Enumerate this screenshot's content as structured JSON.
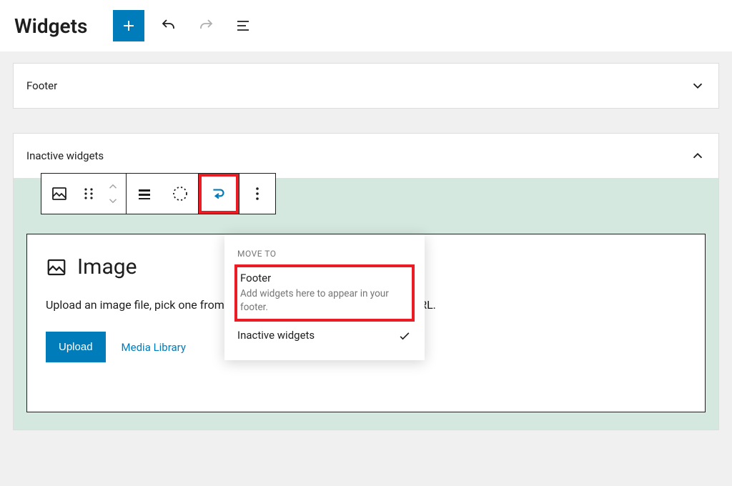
{
  "topbar": {
    "title": "Widgets"
  },
  "areas": {
    "footer": {
      "label": "Footer"
    },
    "inactive": {
      "label": "Inactive widgets"
    }
  },
  "image_block": {
    "title": "Image",
    "description": "Upload an image file, pick one from your media library, or add one with a URL.",
    "upload_label": "Upload",
    "media_library_label": "Media Library"
  },
  "move_popover": {
    "heading": "MOVE TO",
    "footer": {
      "name": "Footer",
      "desc": "Add widgets here to appear in your footer."
    },
    "inactive": {
      "name": "Inactive widgets"
    }
  }
}
